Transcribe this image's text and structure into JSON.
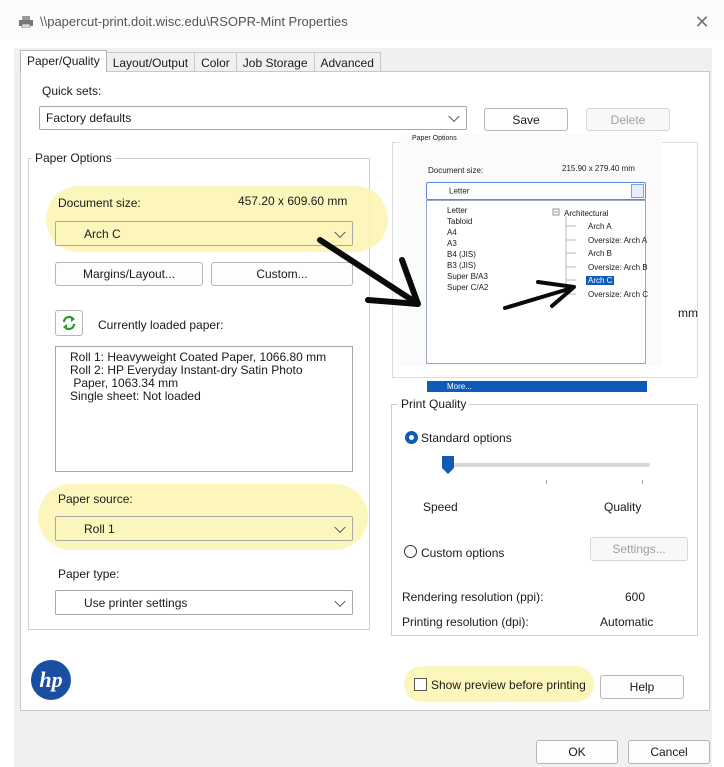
{
  "window": {
    "title": "\\\\papercut-print.doit.wisc.edu\\RSOPR-Mint Properties",
    "close_glyph": "✕"
  },
  "tabs": [
    "Paper/Quality",
    "Layout/Output",
    "Color",
    "Job Storage",
    "Advanced"
  ],
  "quick_sets": {
    "label": "Quick sets:",
    "value": "Factory defaults",
    "save_label": "Save",
    "delete_label": "Delete"
  },
  "paper_options": {
    "group_title": "Paper Options",
    "document_size_label": "Document size:",
    "document_size_dims": "457.20 x 609.60 mm",
    "document_size_value": "Arch C",
    "margins_label": "Margins/Layout...",
    "custom_label": "Custom...",
    "loaded_paper_label": "Currently loaded paper:",
    "loaded_paper_lines": [
      "Roll 1: Heavyweight Coated Paper, 1066.80 mm",
      "Roll 2: HP Everyday Instant-dry Satin Photo",
      " Paper, 1063.34 mm",
      "Single sheet: Not loaded"
    ],
    "paper_source_label": "Paper source:",
    "paper_source_value": "Roll 1",
    "paper_type_label": "Paper type:",
    "paper_type_value": "Use printer settings"
  },
  "inset": {
    "group_title": "Paper Options",
    "document_size_label": "Document size:",
    "document_size_dims": "215.90 x 279.40 mm",
    "combo_value": "Letter",
    "list_items": [
      "Letter",
      "Tabloid",
      "A4",
      "A3",
      "B4 (JIS)",
      "B3 (JIS)",
      "Super B/A3",
      "Super C/A2",
      "More..."
    ],
    "tree_root": "Architectural",
    "tree_items": [
      "Arch A",
      "Oversize: Arch A",
      "Arch B",
      "Oversize: Arch B",
      "Arch C",
      "Oversize: Arch C"
    ],
    "right_unit": "mm"
  },
  "print_quality": {
    "group_title": "Print Quality",
    "standard_label": "Standard options",
    "speed_label": "Speed",
    "quality_label": "Quality",
    "custom_label": "Custom options",
    "settings_label": "Settings...",
    "rendering_label": "Rendering resolution (ppi):",
    "rendering_value": "600",
    "printing_label": "Printing resolution (dpi):",
    "printing_value": "Automatic"
  },
  "footer": {
    "logo_text": "hp",
    "preview_label": "Show preview before printing",
    "help_label": "Help",
    "ok_label": "OK",
    "cancel_label": "Cancel"
  },
  "colors": {
    "accent": "#0e5cb8",
    "highlight": "#fdf5b0",
    "hp_blue": "#1a4ea1"
  }
}
